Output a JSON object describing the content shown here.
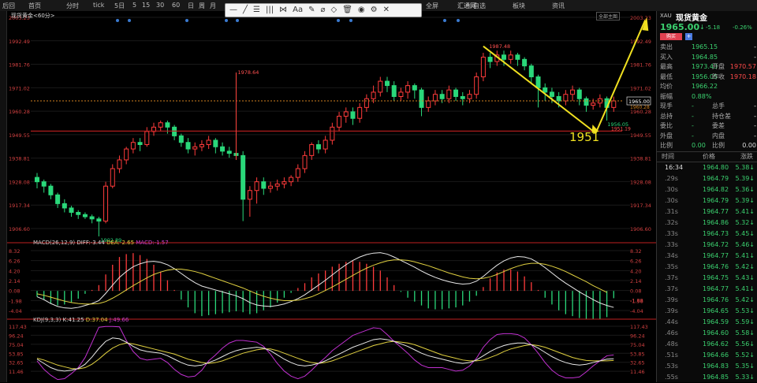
{
  "topbar": {
    "items": [
      "后回",
      "首页",
      "分时",
      "tick",
      "5日",
      "5",
      "15",
      "30",
      "60",
      "日",
      "周",
      "月",
      "全屏",
      "自选",
      "板块",
      "资讯",
      "汇通网"
    ]
  },
  "drawbar": {
    "tools": [
      "—",
      "╱",
      "☰",
      "|||",
      "⋈",
      "Aa",
      "✎",
      "⌀",
      "◇",
      "🗑",
      "◉",
      "⚙",
      "✕"
    ]
  },
  "instrument": {
    "label": "现货黄金<60分>",
    "code": "XAU",
    "name": "现货黄金",
    "price": "1965.00",
    "arrow": "↓",
    "change": "-5.18",
    "change_pct": "-0.26%",
    "buy_btn": "购买",
    "add_btn": "+",
    "full_label": "全部主图"
  },
  "quote": [
    {
      "l1": "卖出",
      "v1": "1965.15",
      "l2": "",
      "v2": "-"
    },
    {
      "l1": "买入",
      "v1": "1964.85",
      "l2": "",
      "v2": "-"
    },
    {
      "l1": "最高",
      "v1": "1973.43",
      "l2": "开盘",
      "v2": "1970.57"
    },
    {
      "l1": "最低",
      "v1": "1956.05",
      "l2": "昨收",
      "v2": "1970.18"
    },
    {
      "l1": "均价",
      "v1": "1966.22",
      "l2": "",
      "v2": ""
    },
    {
      "l1": "振幅",
      "v1": "0.88%",
      "l2": "",
      "v2": ""
    },
    {
      "l1": "现手",
      "v1": "-",
      "l2": "总手",
      "v2": "-"
    },
    {
      "l1": "总持",
      "v1": "-",
      "l2": "持仓差",
      "v2": "-"
    },
    {
      "l1": "委比",
      "v1": "-",
      "l2": "委差",
      "v2": "-"
    },
    {
      "l1": "外盘",
      "v1": "-",
      "l2": "内盘",
      "v2": "-"
    },
    {
      "l1": "比例",
      "v1": "0.00",
      "l2": "比例",
      "v2": "0.00"
    }
  ],
  "ticks_header": [
    "时间",
    "价格",
    "涨跌"
  ],
  "ticks": [
    {
      "t": "16:34",
      "p": "1964.80",
      "c": "5.38"
    },
    {
      "t": ".29s",
      "p": "1964.79",
      "c": "5.39"
    },
    {
      "t": ".30s",
      "p": "1964.82",
      "c": "5.36"
    },
    {
      "t": ".30s",
      "p": "1964.79",
      "c": "5.39"
    },
    {
      "t": ".31s",
      "p": "1964.77",
      "c": "5.41"
    },
    {
      "t": ".32s",
      "p": "1964.86",
      "c": "5.32"
    },
    {
      "t": ".33s",
      "p": "1964.73",
      "c": "5.45"
    },
    {
      "t": ".33s",
      "p": "1964.72",
      "c": "5.46"
    },
    {
      "t": ".34s",
      "p": "1964.77",
      "c": "5.41"
    },
    {
      "t": ".35s",
      "p": "1964.76",
      "c": "5.42"
    },
    {
      "t": ".37s",
      "p": "1964.75",
      "c": "5.43"
    },
    {
      "t": ".37s",
      "p": "1964.77",
      "c": "5.41"
    },
    {
      "t": ".39s",
      "p": "1964.76",
      "c": "5.42"
    },
    {
      "t": ".39s",
      "p": "1964.65",
      "c": "5.53"
    },
    {
      "t": ".44s",
      "p": "1964.59",
      "c": "5.59"
    },
    {
      "t": ".46s",
      "p": "1964.60",
      "c": "5.58"
    },
    {
      "t": ".48s",
      "p": "1964.62",
      "c": "5.56"
    },
    {
      "t": ".51s",
      "p": "1964.66",
      "c": "5.52"
    },
    {
      "t": ".53s",
      "p": "1964.83",
      "c": "5.35"
    },
    {
      "t": ".55s",
      "p": "1964.85",
      "c": "5.33"
    }
  ],
  "annotation_1951": "1951",
  "chart_data": [
    {
      "type": "candlestick",
      "title": "现货黄金<60分>",
      "yticks": [
        "2003.23",
        "1992.49",
        "1981.76",
        "1971.02",
        "1960.28",
        "1949.55",
        "1938.81",
        "1928.08",
        "1917.34",
        "1906.60"
      ],
      "ylim": [
        1906.6,
        2003.23
      ],
      "labels": {
        "high": "1987.48",
        "low": "1902.89",
        "mid_high": "1978.64",
        "last_low": "1956.05",
        "current": "1965.00",
        "right_red": "1951.19",
        "right_orange": "1960.28"
      },
      "hlines": {
        "orange_dashed": 1965.0,
        "red_solid": 1951.19
      },
      "candles": [
        [
          1930,
          1928,
          1932,
          1925
        ],
        [
          1928,
          1926,
          1929,
          1923
        ],
        [
          1926,
          1922,
          1927,
          1920
        ],
        [
          1922,
          1918,
          1923,
          1916
        ],
        [
          1918,
          1916,
          1920,
          1914
        ],
        [
          1916,
          1914,
          1917,
          1912
        ],
        [
          1914,
          1913,
          1915,
          1911
        ],
        [
          1913,
          1912,
          1914,
          1911
        ],
        [
          1912,
          1911,
          1913,
          1909
        ],
        [
          1911,
          1910,
          1912,
          1903
        ],
        [
          1910,
          1926,
          1928,
          1909
        ],
        [
          1926,
          1934,
          1936,
          1925
        ],
        [
          1934,
          1938,
          1940,
          1932
        ],
        [
          1938,
          1943,
          1944,
          1936
        ],
        [
          1943,
          1946,
          1948,
          1941
        ],
        [
          1946,
          1945,
          1948,
          1942
        ],
        [
          1945,
          1951,
          1953,
          1944
        ],
        [
          1951,
          1953,
          1955,
          1949
        ],
        [
          1953,
          1955,
          1956,
          1951
        ],
        [
          1955,
          1953,
          1956,
          1950
        ],
        [
          1953,
          1949,
          1954,
          1947
        ],
        [
          1949,
          1946,
          1950,
          1944
        ],
        [
          1946,
          1943,
          1948,
          1941
        ],
        [
          1943,
          1944,
          1946,
          1940
        ],
        [
          1944,
          1945,
          1947,
          1942
        ],
        [
          1945,
          1947,
          1949,
          1943
        ],
        [
          1947,
          1944,
          1948,
          1941
        ],
        [
          1944,
          1942,
          1946,
          1940
        ],
        [
          1942,
          1941,
          1944,
          1939
        ],
        [
          1941,
          1940,
          1978,
          1938
        ],
        [
          1940,
          1920,
          1942,
          1910
        ],
        [
          1920,
          1924,
          1926,
          1912
        ],
        [
          1924,
          1928,
          1930,
          1918
        ],
        [
          1928,
          1925,
          1930,
          1922
        ],
        [
          1925,
          1926,
          1928,
          1923
        ],
        [
          1926,
          1927,
          1929,
          1924
        ],
        [
          1927,
          1928,
          1930,
          1925
        ],
        [
          1928,
          1930,
          1931,
          1926
        ],
        [
          1930,
          1934,
          1936,
          1928
        ],
        [
          1934,
          1940,
          1942,
          1932
        ],
        [
          1940,
          1945,
          1946,
          1938
        ],
        [
          1945,
          1943,
          1947,
          1941
        ],
        [
          1943,
          1947,
          1949,
          1941
        ],
        [
          1947,
          1953,
          1955,
          1945
        ],
        [
          1953,
          1958,
          1960,
          1951
        ],
        [
          1958,
          1960,
          1962,
          1955
        ],
        [
          1960,
          1957,
          1962,
          1954
        ],
        [
          1957,
          1962,
          1964,
          1955
        ],
        [
          1962,
          1966,
          1968,
          1960
        ],
        [
          1966,
          1969,
          1972,
          1964
        ],
        [
          1969,
          1974,
          1976,
          1967
        ],
        [
          1974,
          1972,
          1976,
          1969
        ],
        [
          1972,
          1967,
          1974,
          1965
        ],
        [
          1967,
          1969,
          1971,
          1965
        ],
        [
          1969,
          1972,
          1974,
          1966
        ],
        [
          1972,
          1970,
          1973,
          1966
        ],
        [
          1970,
          1962,
          1971,
          1958
        ],
        [
          1962,
          1965,
          1967,
          1960
        ],
        [
          1965,
          1968,
          1970,
          1963
        ],
        [
          1968,
          1966,
          1970,
          1964
        ],
        [
          1966,
          1970,
          1972,
          1964
        ],
        [
          1970,
          1967,
          1971,
          1965
        ],
        [
          1967,
          1966,
          1969,
          1963
        ],
        [
          1966,
          1968,
          1970,
          1964
        ],
        [
          1968,
          1976,
          1978,
          1966
        ],
        [
          1976,
          1985,
          1987,
          1974
        ],
        [
          1985,
          1983,
          1987,
          1980
        ],
        [
          1983,
          1986,
          1988,
          1981
        ],
        [
          1986,
          1984,
          1988,
          1981
        ],
        [
          1984,
          1986,
          1988,
          1982
        ],
        [
          1986,
          1984,
          1987,
          1981
        ],
        [
          1984,
          1981,
          1985,
          1979
        ],
        [
          1981,
          1976,
          1982,
          1973
        ],
        [
          1976,
          1971,
          1977,
          1962
        ],
        [
          1971,
          1969,
          1973,
          1965
        ],
        [
          1969,
          1967,
          1971,
          1964
        ],
        [
          1967,
          1965,
          1969,
          1962
        ],
        [
          1965,
          1968,
          1970,
          1963
        ],
        [
          1968,
          1970,
          1972,
          1965
        ],
        [
          1970,
          1966,
          1971,
          1963
        ],
        [
          1966,
          1963,
          1967,
          1960
        ],
        [
          1963,
          1964,
          1966,
          1961
        ],
        [
          1964,
          1966,
          1968,
          1962
        ],
        [
          1966,
          1962,
          1967,
          1956
        ],
        [
          1962,
          1965,
          1967,
          1960
        ]
      ]
    },
    {
      "type": "bar+line",
      "title": "MACD(26,12,9)",
      "legend": [
        "DIFF:-3.44",
        "DEA:-2.65",
        "MACD:-1.57"
      ],
      "yticks": [
        "8.32",
        "6.26",
        "4.20",
        "2.14",
        "0.08",
        "-1.98",
        "-4.04"
      ],
      "ylim": [
        -4.04,
        8.32
      ],
      "current_label": "-1.88",
      "diff": [
        -1.2,
        -1.8,
        -2.6,
        -3.2,
        -3.5,
        -3.6,
        -3.4,
        -3.0,
        -2.6,
        -2.0,
        -0.5,
        1.2,
        2.8,
        4.0,
        5.0,
        5.6,
        6.0,
        6.1,
        5.9,
        5.4,
        4.6,
        3.6,
        2.6,
        1.7,
        1.0,
        0.6,
        0.2,
        -0.2,
        -0.6,
        -1.0,
        -1.6,
        -2.4,
        -2.9,
        -3.1,
        -3.2,
        -3.0,
        -2.7,
        -2.2,
        -1.6,
        -0.8,
        0.2,
        1.2,
        2.2,
        3.3,
        4.4,
        5.4,
        6.3,
        7.0,
        7.5,
        7.8,
        7.9,
        7.6,
        7.0,
        6.3,
        5.6,
        4.9,
        4.1,
        3.4,
        2.8,
        2.3,
        1.9,
        1.6,
        1.4,
        1.5,
        2.0,
        3.0,
        4.2,
        5.3,
        6.2,
        6.8,
        7.1,
        7.0,
        6.6,
        5.8,
        4.8,
        3.7,
        2.6,
        1.6,
        0.7,
        -0.2,
        -1.0,
        -1.8,
        -2.5,
        -3.0,
        -3.4
      ],
      "dea": [
        -0.6,
        -0.9,
        -1.3,
        -1.7,
        -2.1,
        -2.4,
        -2.6,
        -2.7,
        -2.7,
        -2.6,
        -2.2,
        -1.5,
        -0.7,
        0.2,
        1.1,
        1.9,
        2.7,
        3.4,
        3.9,
        4.3,
        4.5,
        4.5,
        4.3,
        4.0,
        3.6,
        3.1,
        2.6,
        2.1,
        1.6,
        1.1,
        0.6,
        0.0,
        -0.6,
        -1.1,
        -1.5,
        -1.8,
        -2.0,
        -2.0,
        -1.9,
        -1.6,
        -1.2,
        -0.6,
        0.1,
        0.8,
        1.6,
        2.4,
        3.2,
        4.0,
        4.7,
        5.3,
        5.8,
        6.2,
        6.4,
        6.4,
        6.3,
        6.0,
        5.6,
        5.2,
        4.7,
        4.2,
        3.7,
        3.3,
        2.9,
        2.6,
        2.5,
        2.6,
        2.9,
        3.4,
        4.0,
        4.6,
        5.1,
        5.5,
        5.7,
        5.7,
        5.5,
        5.1,
        4.6,
        4.0,
        3.3,
        2.6,
        1.9,
        1.1,
        0.4,
        -0.3,
        -2.65
      ]
    },
    {
      "type": "line",
      "title": "KDJ(9,3,3)",
      "legend": [
        "K:41.25",
        "D:37.04",
        "J:49.66"
      ],
      "yticks": [
        "117.43",
        "96.24",
        "75.04",
        "53.85",
        "32.65",
        "11.46"
      ],
      "ylim": [
        0,
        117.43
      ],
      "k": [
        40,
        30,
        20,
        14,
        12,
        14,
        18,
        28,
        45,
        65,
        82,
        90,
        88,
        80,
        70,
        62,
        58,
        56,
        54,
        48,
        40,
        32,
        26,
        24,
        26,
        32,
        38,
        46,
        54,
        60,
        64,
        66,
        68,
        66,
        60,
        50,
        40,
        32,
        26,
        24,
        26,
        30,
        36,
        44,
        52,
        60,
        68,
        74,
        80,
        86,
        88,
        86,
        82,
        76,
        70,
        62,
        54,
        48,
        44,
        40,
        36,
        32,
        30,
        32,
        38,
        48,
        58,
        66,
        72,
        76,
        78,
        78,
        74,
        66,
        56,
        46,
        38,
        32,
        28,
        26,
        28,
        32,
        36,
        40,
        41
      ],
      "d": [
        42,
        38,
        32,
        26,
        22,
        18,
        17,
        20,
        28,
        40,
        54,
        66,
        74,
        78,
        76,
        72,
        68,
        64,
        60,
        56,
        52,
        46,
        40,
        36,
        32,
        30,
        32,
        36,
        42,
        48,
        54,
        58,
        62,
        64,
        64,
        60,
        54,
        48,
        42,
        36,
        32,
        30,
        32,
        36,
        42,
        48,
        54,
        60,
        66,
        72,
        76,
        80,
        82,
        80,
        78,
        74,
        68,
        62,
        56,
        50,
        46,
        42,
        38,
        36,
        36,
        38,
        44,
        50,
        58,
        64,
        68,
        72,
        74,
        72,
        68,
        62,
        56,
        50,
        44,
        40,
        37,
        36,
        36,
        36,
        37
      ],
      "j": [
        36,
        16,
        2,
        -8,
        -6,
        6,
        20,
        44,
        79,
        115,
        117,
        117,
        116,
        84,
        58,
        42,
        38,
        40,
        42,
        32,
        16,
        4,
        -2,
        0,
        14,
        36,
        50,
        66,
        78,
        84,
        84,
        82,
        80,
        70,
        52,
        30,
        12,
        0,
        -6,
        0,
        14,
        30,
        44,
        60,
        72,
        84,
        96,
        102,
        108,
        114,
        112,
        98,
        82,
        68,
        54,
        38,
        26,
        20,
        20,
        20,
        16,
        12,
        14,
        24,
        42,
        68,
        86,
        98,
        100,
        100,
        98,
        90,
        74,
        54,
        32,
        14,
        2,
        -4,
        -4,
        -2,
        10,
        24,
        36,
        48,
        50
      ]
    }
  ]
}
